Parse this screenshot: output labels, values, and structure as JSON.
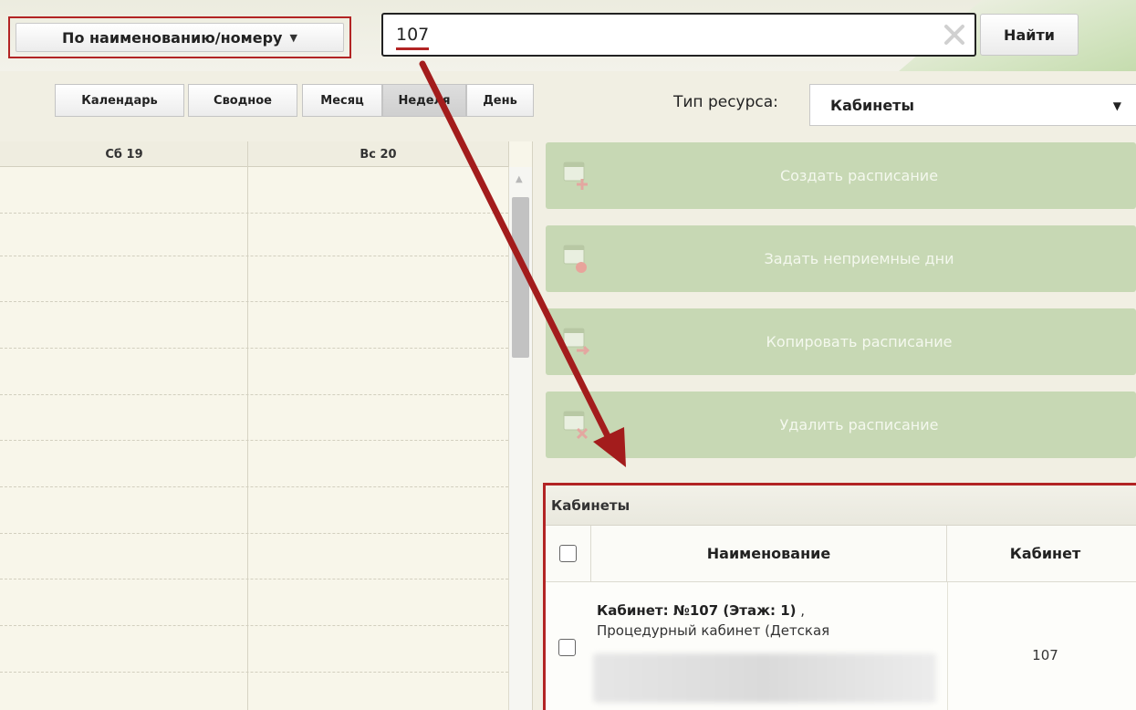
{
  "search": {
    "mode_label": "По наименованию/номеру",
    "value": "107",
    "find_label": "Найти"
  },
  "views": {
    "calendar": "Календарь",
    "summary": "Сводное",
    "month": "Месяц",
    "week": "Неделя",
    "day": "День",
    "active": "Неделя"
  },
  "resource": {
    "label": "Тип ресурса:",
    "value": "Кабинеты"
  },
  "calendar": {
    "columns": [
      "Сб 19",
      "Вс 20"
    ]
  },
  "actions": {
    "create": "Создать расписание",
    "nonworking": "Задать неприемные дни",
    "copy": "Копировать расписание",
    "delete": "Удалить расписание"
  },
  "cabinets": {
    "title": "Кабинеты",
    "headers": {
      "name": "Наименование",
      "cabinet": "Кабинет"
    },
    "rows": [
      {
        "name_bold": "Кабинет: №107 (Этаж: 1)",
        "name_suffix": " ,",
        "desc": "Процедурный кабинет (Детская",
        "cabinet": "107"
      }
    ]
  },
  "colors": {
    "highlight": "#b22424",
    "action_button": "#c7d8b4",
    "background": "#f1efe3"
  },
  "icons": [
    "caret-down-icon",
    "clear-icon",
    "calendar-add-icon",
    "calendar-block-icon",
    "calendar-copy-icon",
    "calendar-delete-icon",
    "arrow-annotation-icon"
  ]
}
